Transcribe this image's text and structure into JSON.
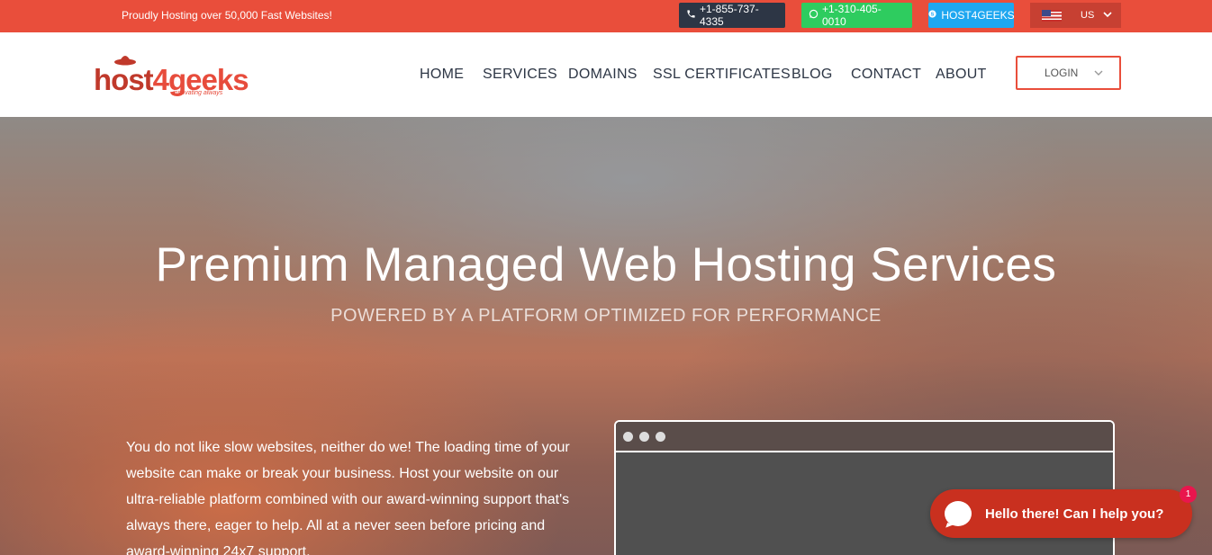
{
  "topbar": {
    "tagline": "Proudly Hosting over 50,000 Fast Websites!",
    "phone": "+1-855-737-4335",
    "whatsapp": "+1-310-405-0010",
    "skype": "HOST4GEEKS",
    "language": "US",
    "bg_color": "#e94e3b"
  },
  "header": {
    "logo_main_a": "host",
    "logo_main_b": "4geeks",
    "logo_tagline": "innovating always",
    "nav": [
      "HOME",
      "SERVICES",
      "DOMAINS",
      "SSL CERTIFICATES",
      "BLOG",
      "CONTACT",
      "ABOUT"
    ],
    "login_label": "LOGIN"
  },
  "hero": {
    "title": "Premium Managed Web Hosting Services",
    "subtitle": "POWERED BY A PLATFORM OPTIMIZED FOR PERFORMANCE",
    "body": "You do not like slow websites, neither do we! The loading time of your website can make or break your business. Host your website on our ultra-reliable platform combined with our award-winning support that's always there, eager to help. All at a never seen before pricing and award-winning 24x7 support."
  },
  "chat": {
    "message": "Hello there! Can I help you?",
    "badge_count": "1"
  }
}
